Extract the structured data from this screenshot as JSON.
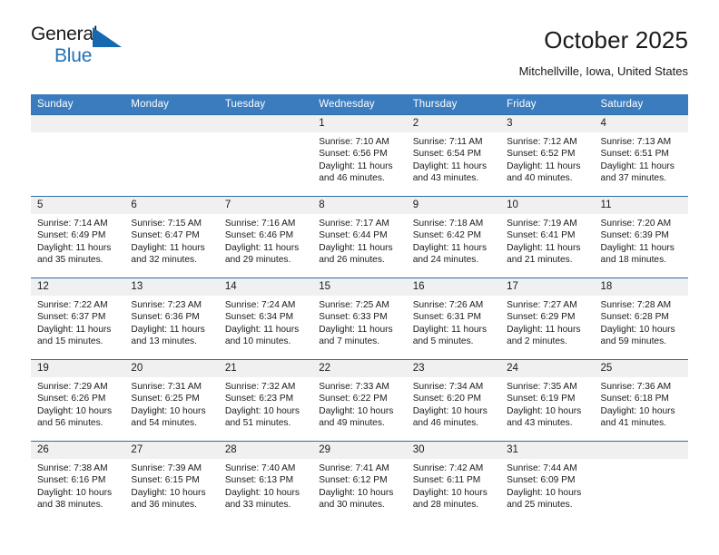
{
  "brand": {
    "name_top": "General",
    "name_bottom": "Blue",
    "accent_color": "#1669b0"
  },
  "header": {
    "title": "October 2025",
    "subtitle": "Mitchellville, Iowa, United States"
  },
  "theme": {
    "header_row_bg": "#3a7cbe",
    "daynum_bg": "#f0f0f0",
    "text_color": "#1a1a1a"
  },
  "weekday_headers": [
    "Sunday",
    "Monday",
    "Tuesday",
    "Wednesday",
    "Thursday",
    "Friday",
    "Saturday"
  ],
  "labels": {
    "sunrise": "Sunrise:",
    "sunset": "Sunset:",
    "daylight": "Daylight:"
  },
  "weeks": [
    [
      {
        "day": "",
        "empty": true
      },
      {
        "day": "",
        "empty": true
      },
      {
        "day": "",
        "empty": true
      },
      {
        "day": "1",
        "sunrise": "Sunrise: 7:10 AM",
        "sunset": "Sunset: 6:56 PM",
        "daylight": "Daylight: 11 hours and 46 minutes."
      },
      {
        "day": "2",
        "sunrise": "Sunrise: 7:11 AM",
        "sunset": "Sunset: 6:54 PM",
        "daylight": "Daylight: 11 hours and 43 minutes."
      },
      {
        "day": "3",
        "sunrise": "Sunrise: 7:12 AM",
        "sunset": "Sunset: 6:52 PM",
        "daylight": "Daylight: 11 hours and 40 minutes."
      },
      {
        "day": "4",
        "sunrise": "Sunrise: 7:13 AM",
        "sunset": "Sunset: 6:51 PM",
        "daylight": "Daylight: 11 hours and 37 minutes."
      }
    ],
    [
      {
        "day": "5",
        "sunrise": "Sunrise: 7:14 AM",
        "sunset": "Sunset: 6:49 PM",
        "daylight": "Daylight: 11 hours and 35 minutes."
      },
      {
        "day": "6",
        "sunrise": "Sunrise: 7:15 AM",
        "sunset": "Sunset: 6:47 PM",
        "daylight": "Daylight: 11 hours and 32 minutes."
      },
      {
        "day": "7",
        "sunrise": "Sunrise: 7:16 AM",
        "sunset": "Sunset: 6:46 PM",
        "daylight": "Daylight: 11 hours and 29 minutes."
      },
      {
        "day": "8",
        "sunrise": "Sunrise: 7:17 AM",
        "sunset": "Sunset: 6:44 PM",
        "daylight": "Daylight: 11 hours and 26 minutes."
      },
      {
        "day": "9",
        "sunrise": "Sunrise: 7:18 AM",
        "sunset": "Sunset: 6:42 PM",
        "daylight": "Daylight: 11 hours and 24 minutes."
      },
      {
        "day": "10",
        "sunrise": "Sunrise: 7:19 AM",
        "sunset": "Sunset: 6:41 PM",
        "daylight": "Daylight: 11 hours and 21 minutes."
      },
      {
        "day": "11",
        "sunrise": "Sunrise: 7:20 AM",
        "sunset": "Sunset: 6:39 PM",
        "daylight": "Daylight: 11 hours and 18 minutes."
      }
    ],
    [
      {
        "day": "12",
        "sunrise": "Sunrise: 7:22 AM",
        "sunset": "Sunset: 6:37 PM",
        "daylight": "Daylight: 11 hours and 15 minutes."
      },
      {
        "day": "13",
        "sunrise": "Sunrise: 7:23 AM",
        "sunset": "Sunset: 6:36 PM",
        "daylight": "Daylight: 11 hours and 13 minutes."
      },
      {
        "day": "14",
        "sunrise": "Sunrise: 7:24 AM",
        "sunset": "Sunset: 6:34 PM",
        "daylight": "Daylight: 11 hours and 10 minutes."
      },
      {
        "day": "15",
        "sunrise": "Sunrise: 7:25 AM",
        "sunset": "Sunset: 6:33 PM",
        "daylight": "Daylight: 11 hours and 7 minutes."
      },
      {
        "day": "16",
        "sunrise": "Sunrise: 7:26 AM",
        "sunset": "Sunset: 6:31 PM",
        "daylight": "Daylight: 11 hours and 5 minutes."
      },
      {
        "day": "17",
        "sunrise": "Sunrise: 7:27 AM",
        "sunset": "Sunset: 6:29 PM",
        "daylight": "Daylight: 11 hours and 2 minutes."
      },
      {
        "day": "18",
        "sunrise": "Sunrise: 7:28 AM",
        "sunset": "Sunset: 6:28 PM",
        "daylight": "Daylight: 10 hours and 59 minutes."
      }
    ],
    [
      {
        "day": "19",
        "sunrise": "Sunrise: 7:29 AM",
        "sunset": "Sunset: 6:26 PM",
        "daylight": "Daylight: 10 hours and 56 minutes."
      },
      {
        "day": "20",
        "sunrise": "Sunrise: 7:31 AM",
        "sunset": "Sunset: 6:25 PM",
        "daylight": "Daylight: 10 hours and 54 minutes."
      },
      {
        "day": "21",
        "sunrise": "Sunrise: 7:32 AM",
        "sunset": "Sunset: 6:23 PM",
        "daylight": "Daylight: 10 hours and 51 minutes."
      },
      {
        "day": "22",
        "sunrise": "Sunrise: 7:33 AM",
        "sunset": "Sunset: 6:22 PM",
        "daylight": "Daylight: 10 hours and 49 minutes."
      },
      {
        "day": "23",
        "sunrise": "Sunrise: 7:34 AM",
        "sunset": "Sunset: 6:20 PM",
        "daylight": "Daylight: 10 hours and 46 minutes."
      },
      {
        "day": "24",
        "sunrise": "Sunrise: 7:35 AM",
        "sunset": "Sunset: 6:19 PM",
        "daylight": "Daylight: 10 hours and 43 minutes."
      },
      {
        "day": "25",
        "sunrise": "Sunrise: 7:36 AM",
        "sunset": "Sunset: 6:18 PM",
        "daylight": "Daylight: 10 hours and 41 minutes."
      }
    ],
    [
      {
        "day": "26",
        "sunrise": "Sunrise: 7:38 AM",
        "sunset": "Sunset: 6:16 PM",
        "daylight": "Daylight: 10 hours and 38 minutes."
      },
      {
        "day": "27",
        "sunrise": "Sunrise: 7:39 AM",
        "sunset": "Sunset: 6:15 PM",
        "daylight": "Daylight: 10 hours and 36 minutes."
      },
      {
        "day": "28",
        "sunrise": "Sunrise: 7:40 AM",
        "sunset": "Sunset: 6:13 PM",
        "daylight": "Daylight: 10 hours and 33 minutes."
      },
      {
        "day": "29",
        "sunrise": "Sunrise: 7:41 AM",
        "sunset": "Sunset: 6:12 PM",
        "daylight": "Daylight: 10 hours and 30 minutes."
      },
      {
        "day": "30",
        "sunrise": "Sunrise: 7:42 AM",
        "sunset": "Sunset: 6:11 PM",
        "daylight": "Daylight: 10 hours and 28 minutes."
      },
      {
        "day": "31",
        "sunrise": "Sunrise: 7:44 AM",
        "sunset": "Sunset: 6:09 PM",
        "daylight": "Daylight: 10 hours and 25 minutes."
      },
      {
        "day": "",
        "empty": true
      }
    ]
  ]
}
